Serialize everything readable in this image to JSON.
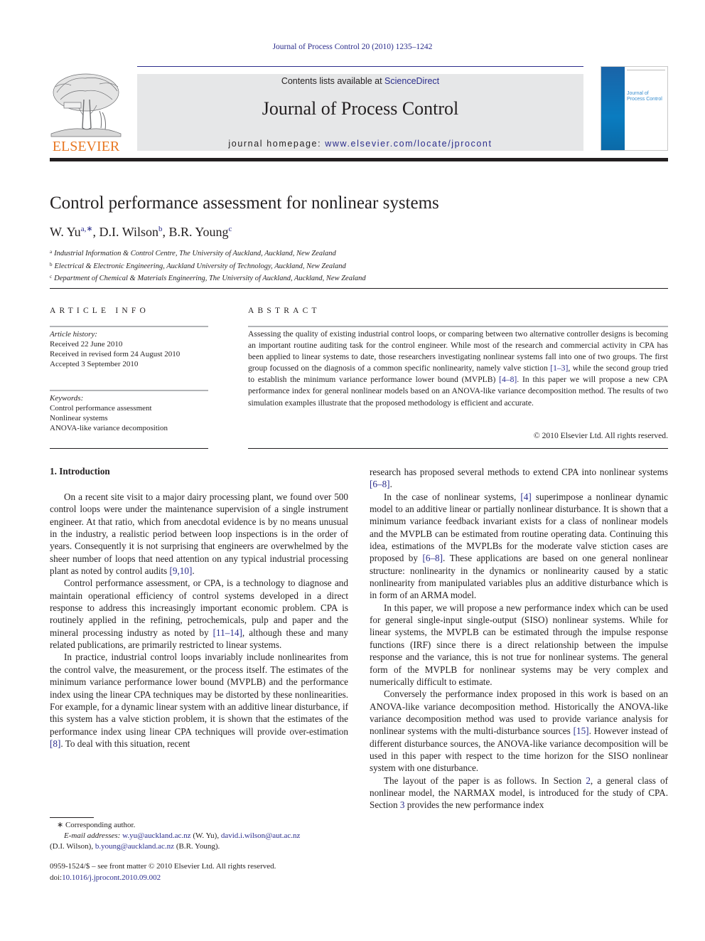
{
  "header": {
    "journal_ref": "Journal of Process Control 20 (2010) 1235–1242",
    "contents_prefix": "Contents lists available at ",
    "contents_link": "ScienceDirect",
    "journal_title": "Journal of Process Control",
    "homepage_prefix": "journal homepage: ",
    "homepage_url": "www.elsevier.com/locate/jprocont",
    "publisher_logo_text": "ELSEVIER",
    "cover_title_line1": "Journal of",
    "cover_title_line2": "Process Control"
  },
  "article": {
    "title": "Control performance assessment for nonlinear systems",
    "authors": [
      {
        "name": "W. Yu",
        "sup": "a,∗"
      },
      {
        "name": "D.I. Wilson",
        "sup": "b"
      },
      {
        "name": "B.R. Young",
        "sup": "c"
      }
    ],
    "affiliations": [
      {
        "sup": "a",
        "text": "Industrial Information & Control Centre, The University of Auckland, Auckland, New Zealand"
      },
      {
        "sup": "b",
        "text": "Electrical & Electronic Engineering, Auckland University of Technology, Auckland, New Zealand"
      },
      {
        "sup": "c",
        "text": "Department of Chemical & Materials Engineering, The University of Auckland, Auckland, New Zealand"
      }
    ]
  },
  "article_info": {
    "heading": "ARTICLE INFO",
    "history_label": "Article history:",
    "history": [
      "Received 22 June 2010",
      "Received in revised form 24 August 2010",
      "Accepted 3 September 2010"
    ],
    "keywords_label": "Keywords:",
    "keywords": [
      "Control performance assessment",
      "Nonlinear systems",
      "ANOVA-like variance decomposition"
    ]
  },
  "abstract": {
    "heading": "ABSTRACT",
    "part1": "Assessing the quality of existing industrial control loops, or comparing between two alternative controller designs is becoming an important routine auditing task for the control engineer. While most of the research and commercial activity in CPA has been applied to linear systems to date, those researchers investigating nonlinear systems fall into one of two groups. The first group focussed on the diagnosis of a common specific nonlinearity, namely valve stiction ",
    "ref1": "[1–3]",
    "part2": ", while the second group tried to establish the minimum variance performance lower bound (MVPLB) ",
    "ref2": "[4–8]",
    "part3": ". In this paper we will propose a new CPA performance index for general nonlinear models based on an ANOVA-like variance decomposition method. The results of two simulation examples illustrate that the proposed methodology is efficient and accurate.",
    "copyright": "© 2010 Elsevier Ltd. All rights reserved."
  },
  "body": {
    "intro_heading": "1.  Introduction",
    "left": {
      "p1a": "On a recent site visit to a major dairy processing plant, we found over 500 control loops were under the maintenance supervision of a single instrument engineer. At that ratio, which from anecdotal evidence is by no means unusual in the industry, a realistic period between loop inspections is in the order of years. Consequently it is not surprising that engineers are overwhelmed by the sheer number of loops that need attention on any typical industrial processing plant as noted by control audits ",
      "p1ref": "[9,10]",
      "p1b": ".",
      "p2a": "Control performance assessment, or CPA, is a technology to diagnose and maintain operational efficiency of control systems developed in a direct response to address this increasingly important economic problem. CPA is routinely applied in the refining, petrochemicals, pulp and paper and the mineral processing industry as noted by ",
      "p2ref": "[11–14]",
      "p2b": ", although these and many related publications, are primarily restricted to linear systems.",
      "p3a": "In practice, industrial control loops invariably include nonlinearites from the control valve, the measurement, or the process itself. The estimates of the minimum variance performance lower bound (MVPLB) and the performance index using the linear CPA techniques may be distorted by these nonlinearities. For example, for a dynamic linear system with an additive linear disturbance, if this system has a valve stiction problem, it is shown that the estimates of the performance index using linear CPA techniques will provide over-estimation ",
      "p3ref": "[8]",
      "p3b": ". To deal with this situation, recent"
    },
    "right": {
      "p0a": "research has proposed several methods to extend CPA into nonlinear systems ",
      "p0ref": "[6–8]",
      "p0b": ".",
      "p1a": "In the case of nonlinear systems, ",
      "p1ref1": "[4]",
      "p1b": " superimpose a nonlinear dynamic model to an additive linear or partially nonlinear disturbance. It is shown that a minimum variance feedback invariant exists for a class of nonlinear models and the MVPLB can be estimated from routine operating data. Continuing this idea, estimations of the MVPLBs for the moderate valve stiction cases are proposed by ",
      "p1ref2": "[6–8]",
      "p1c": ". These applications are based on one general nonlinear structure: nonlinearity in the dynamics or nonlinearity caused by a static nonlinearity from manipulated variables plus an additive disturbance which is in form of an ARMA model.",
      "p2": "In this paper, we will propose a new performance index which can be used for general single-input single-output (SISO) nonlinear systems. While for linear systems, the MVPLB can be estimated through the impulse response functions (IRF) since there is a direct relationship between the impulse response and the variance, this is not true for nonlinear systems. The general form of the MVPLB for nonlinear systems may be very complex and numerically difficult to estimate.",
      "p3a": "Conversely the performance index proposed in this work is based on an ANOVA-like variance decomposition method. Historically the ANOVA-like variance decomposition method was used to provide variance analysis for nonlinear systems with the multi-disturbance sources ",
      "p3ref": "[15]",
      "p3b": ". However instead of different disturbance sources, the ANOVA-like variance decomposition will be used in this paper with respect to the time horizon for the SISO nonlinear system with one disturbance.",
      "p4a": "The layout of the paper is as follows. In Section ",
      "p4ref1": "2",
      "p4b": ", a general class of nonlinear model, the NARMAX model, is introduced for the study of CPA. Section ",
      "p4ref2": "3",
      "p4c": " provides the new performance index"
    }
  },
  "footnotes": {
    "star": "∗ Corresponding author.",
    "email_label": "E-mail addresses: ",
    "email1": "w.yu@auckland.ac.nz",
    "email1_who": " (W. Yu), ",
    "email2": "david.i.wilson@aut.ac.nz",
    "email2_who": " (D.I. Wilson), ",
    "email3": "b.young@auckland.ac.nz",
    "email3_who": " (B.R. Young).",
    "issn": "0959-1524/$ – see front matter © 2010 Elsevier Ltd. All rights reserved.",
    "doi_prefix": "doi:",
    "doi": "10.1016/j.jprocont.2010.09.002"
  }
}
